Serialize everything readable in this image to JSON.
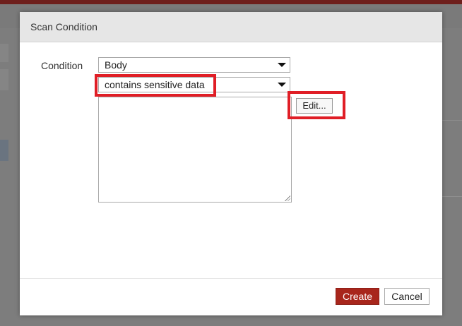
{
  "dialog": {
    "title": "Scan Condition"
  },
  "form": {
    "condition_label": "Condition",
    "field_select": {
      "selected": "Body"
    },
    "operator_select": {
      "selected": "contains sensitive data"
    },
    "edit_label": "Edit..."
  },
  "footer": {
    "create_label": "Create",
    "cancel_label": "Cancel"
  },
  "colors": {
    "primary_button": "#a8261c",
    "highlight": "#e01e26"
  }
}
